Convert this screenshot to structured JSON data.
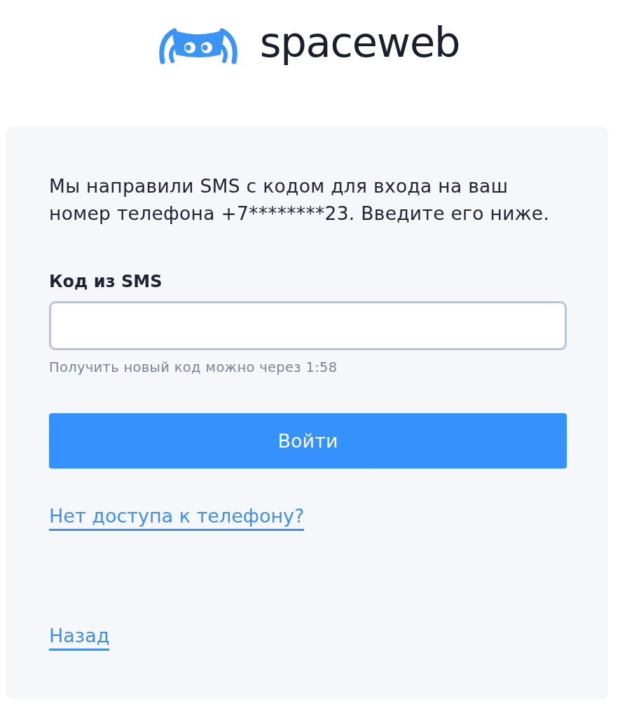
{
  "logo": {
    "wordmark": "spaceweb"
  },
  "card": {
    "message": "Мы направили SMS с кодом для входа на ваш номер телефона +7********23. Введите его ниже.",
    "code_field": {
      "label": "Код из SMS"
    },
    "hint": "Получить новый код можно через 1:58",
    "submit_button": "Войти",
    "links": [
      {
        "label": "Нет доступа к телефону?"
      }
    ],
    "back_link": "Назад"
  }
}
